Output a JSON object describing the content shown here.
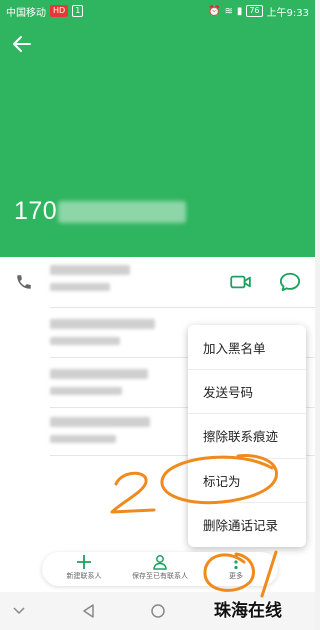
{
  "status_bar": {
    "carrier": "中国移动",
    "badge1": "HD",
    "badge2": "1",
    "battery": "76",
    "time": "上午9:33"
  },
  "contact": {
    "number_visible": "170"
  },
  "menu": {
    "items": [
      "加入黑名单",
      "发送号码",
      "擦除联系痕迹",
      "标记为",
      "删除通话记录"
    ]
  },
  "bottom_bar": {
    "new_contact": "新建联系人",
    "save_existing": "保存至已有联系人",
    "more": "更多"
  },
  "annotations": {
    "mark_2": "2",
    "mark_1": "1"
  },
  "watermark": "珠海在线",
  "colors": {
    "header": "#2fb45f",
    "accent": "#1aa260",
    "annotation": "#f08a1c"
  }
}
